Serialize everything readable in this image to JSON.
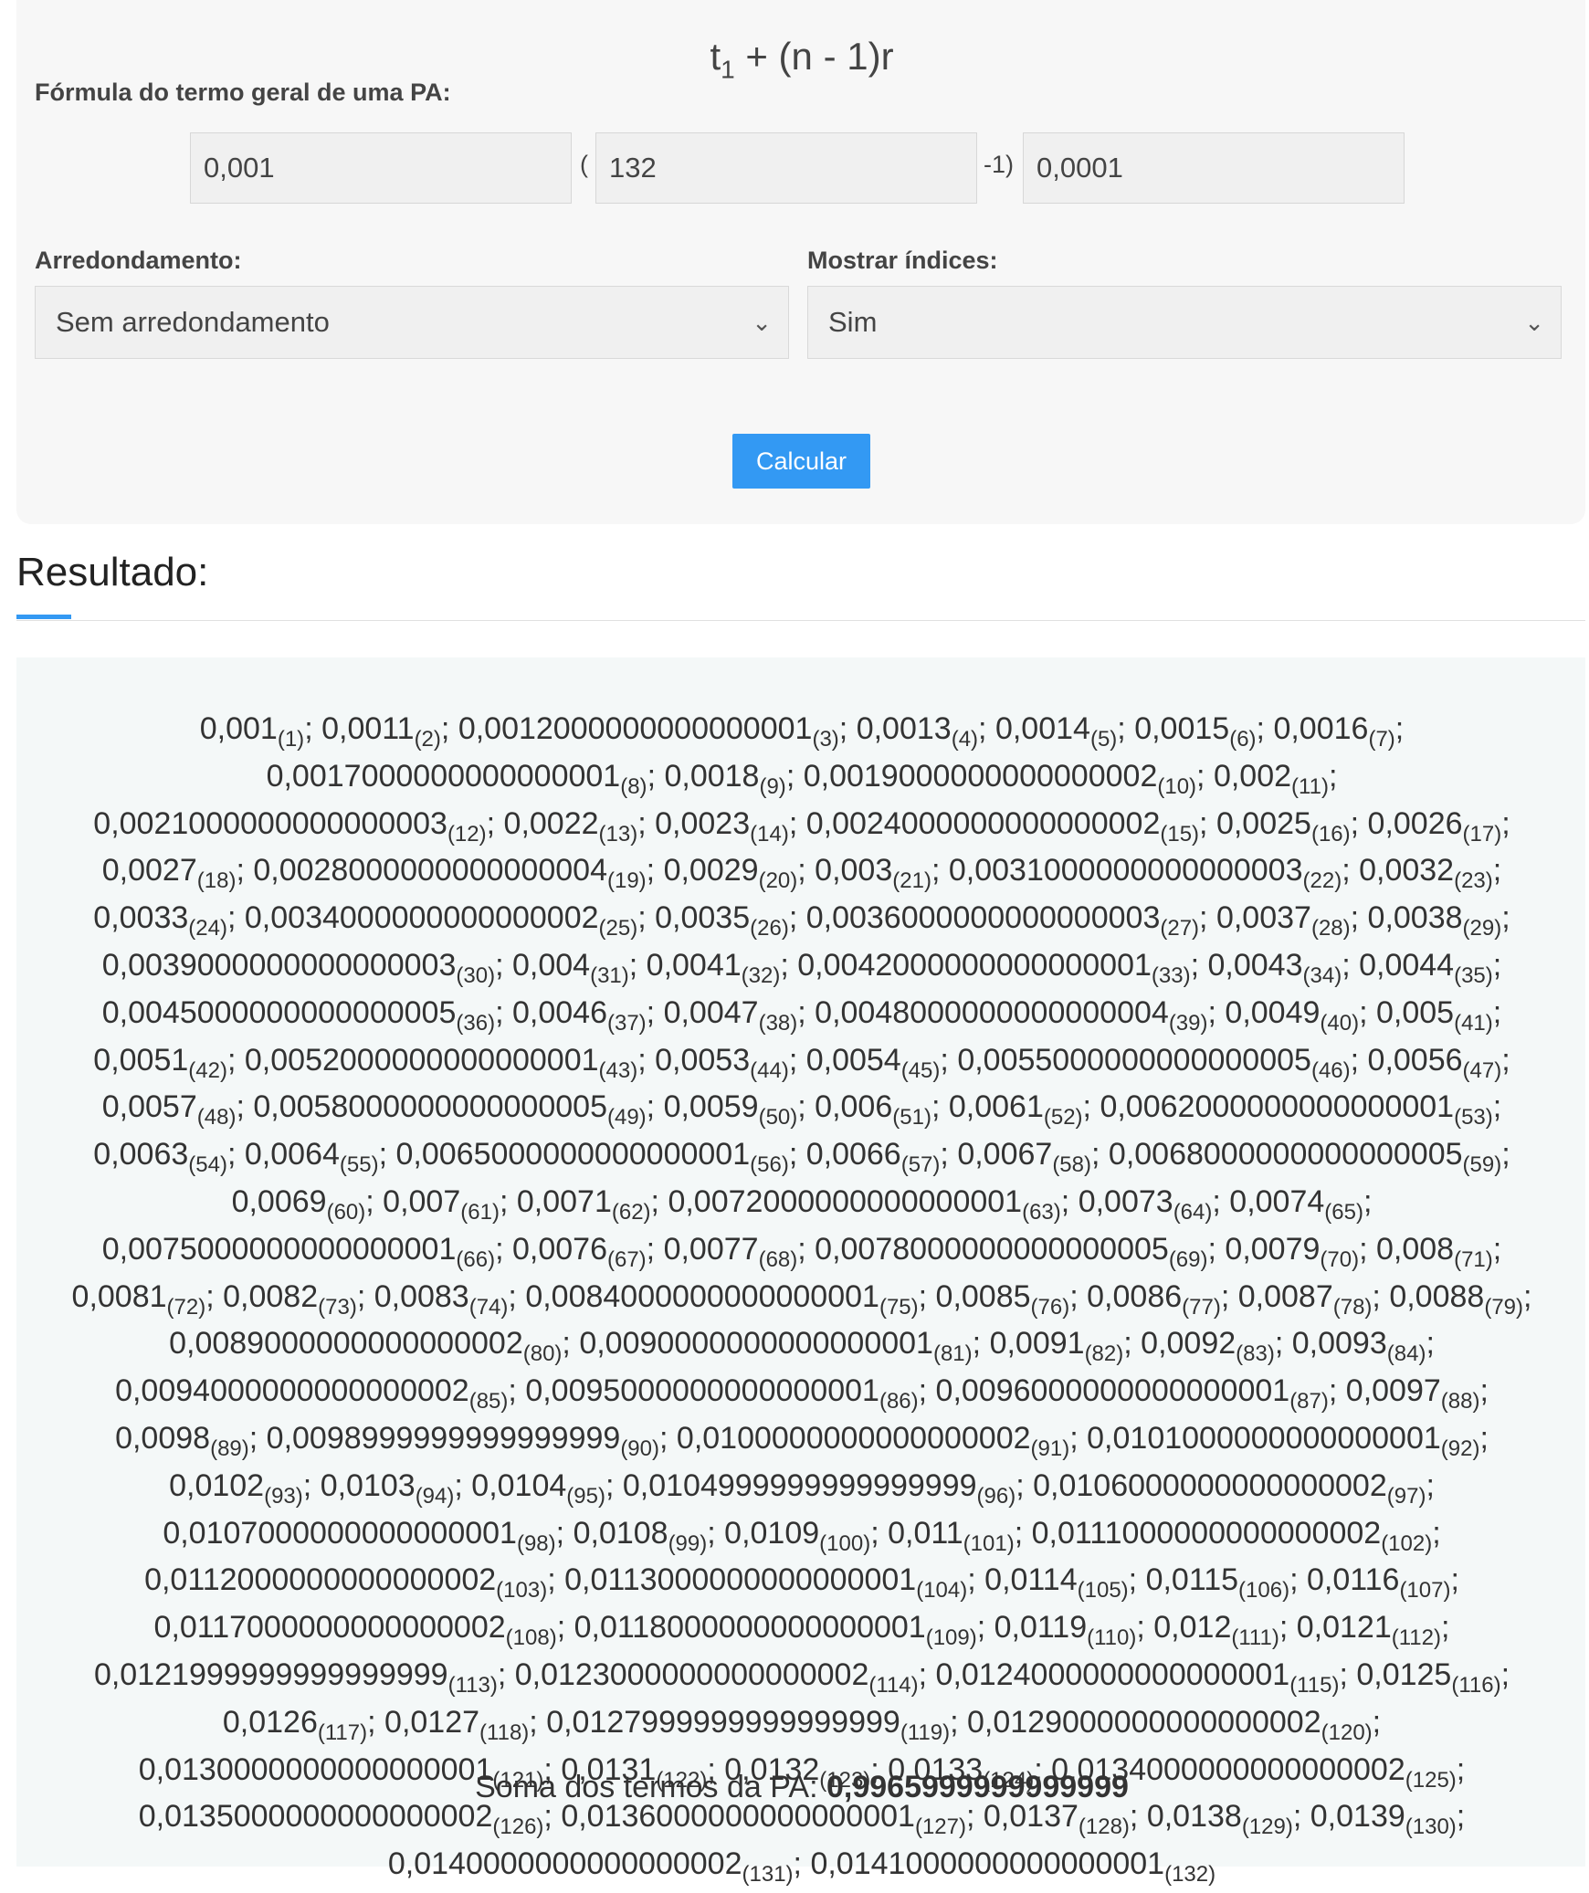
{
  "form": {
    "formula_title": {
      "base": "t",
      "sub": "1",
      "rest": " + (n - 1)r"
    },
    "formula_label": "Fórmula do termo geral de uma PA:",
    "first_term": "0,001",
    "open_paren": "(",
    "n_value": "132",
    "close_part": "-1)",
    "ratio": "0,0001",
    "rounding_label": "Arredondamento:",
    "rounding_value": "Sem arredondamento",
    "indices_label": "Mostrar índices:",
    "indices_value": "Sim",
    "calculate_button": "Calcular"
  },
  "result": {
    "title": "Resultado:",
    "terms": [
      [
        "0,001",
        "(1)"
      ],
      [
        "0,0011",
        "(2)"
      ],
      [
        "0,0012000000000000001",
        "(3)"
      ],
      [
        "0,0013",
        "(4)"
      ],
      [
        "0,0014",
        "(5)"
      ],
      [
        "0,0015",
        "(6)"
      ],
      [
        "0,0016",
        "(7)"
      ],
      [
        "0,0017000000000000001",
        "(8)"
      ],
      [
        "0,0018",
        "(9)"
      ],
      [
        "0,0019000000000000002",
        "(10)"
      ],
      [
        "0,002",
        "(11)"
      ],
      [
        "0,0021000000000000003",
        "(12)"
      ],
      [
        "0,0022",
        "(13)"
      ],
      [
        "0,0023",
        "(14)"
      ],
      [
        "0,0024000000000000002",
        "(15)"
      ],
      [
        "0,0025",
        "(16)"
      ],
      [
        "0,0026",
        "(17)"
      ],
      [
        "0,0027",
        "(18)"
      ],
      [
        "0,0028000000000000004",
        "(19)"
      ],
      [
        "0,0029",
        "(20)"
      ],
      [
        "0,003",
        "(21)"
      ],
      [
        "0,0031000000000000003",
        "(22)"
      ],
      [
        "0,0032",
        "(23)"
      ],
      [
        "0,0033",
        "(24)"
      ],
      [
        "0,0034000000000000002",
        "(25)"
      ],
      [
        "0,0035",
        "(26)"
      ],
      [
        "0,0036000000000000003",
        "(27)"
      ],
      [
        "0,0037",
        "(28)"
      ],
      [
        "0,0038",
        "(29)"
      ],
      [
        "0,0039000000000000003",
        "(30)"
      ],
      [
        "0,004",
        "(31)"
      ],
      [
        "0,0041",
        "(32)"
      ],
      [
        "0,0042000000000000001",
        "(33)"
      ],
      [
        "0,0043",
        "(34)"
      ],
      [
        "0,0044",
        "(35)"
      ],
      [
        "0,0045000000000000005",
        "(36)"
      ],
      [
        "0,0046",
        "(37)"
      ],
      [
        "0,0047",
        "(38)"
      ],
      [
        "0,0048000000000000004",
        "(39)"
      ],
      [
        "0,0049",
        "(40)"
      ],
      [
        "0,005",
        "(41)"
      ],
      [
        "0,0051",
        "(42)"
      ],
      [
        "0,0052000000000000001",
        "(43)"
      ],
      [
        "0,0053",
        "(44)"
      ],
      [
        "0,0054",
        "(45)"
      ],
      [
        "0,0055000000000000005",
        "(46)"
      ],
      [
        "0,0056",
        "(47)"
      ],
      [
        "0,0057",
        "(48)"
      ],
      [
        "0,0058000000000000005",
        "(49)"
      ],
      [
        "0,0059",
        "(50)"
      ],
      [
        "0,006",
        "(51)"
      ],
      [
        "0,0061",
        "(52)"
      ],
      [
        "0,0062000000000000001",
        "(53)"
      ],
      [
        "0,0063",
        "(54)"
      ],
      [
        "0,0064",
        "(55)"
      ],
      [
        "0,0065000000000000001",
        "(56)"
      ],
      [
        "0,0066",
        "(57)"
      ],
      [
        "0,0067",
        "(58)"
      ],
      [
        "0,0068000000000000005",
        "(59)"
      ],
      [
        "0,0069",
        "(60)"
      ],
      [
        "0,007",
        "(61)"
      ],
      [
        "0,0071",
        "(62)"
      ],
      [
        "0,0072000000000000001",
        "(63)"
      ],
      [
        "0,0073",
        "(64)"
      ],
      [
        "0,0074",
        "(65)"
      ],
      [
        "0,0075000000000000001",
        "(66)"
      ],
      [
        "0,0076",
        "(67)"
      ],
      [
        "0,0077",
        "(68)"
      ],
      [
        "0,0078000000000000005",
        "(69)"
      ],
      [
        "0,0079",
        "(70)"
      ],
      [
        "0,008",
        "(71)"
      ],
      [
        "0,0081",
        "(72)"
      ],
      [
        "0,0082",
        "(73)"
      ],
      [
        "0,0083",
        "(74)"
      ],
      [
        "0,0084000000000000001",
        "(75)"
      ],
      [
        "0,0085",
        "(76)"
      ],
      [
        "0,0086",
        "(77)"
      ],
      [
        "0,0087",
        "(78)"
      ],
      [
        "0,0088",
        "(79)"
      ],
      [
        "0,0089000000000000002",
        "(80)"
      ],
      [
        "0,0090000000000000001",
        "(81)"
      ],
      [
        "0,0091",
        "(82)"
      ],
      [
        "0,0092",
        "(83)"
      ],
      [
        "0,0093",
        "(84)"
      ],
      [
        "0,0094000000000000002",
        "(85)"
      ],
      [
        "0,0095000000000000001",
        "(86)"
      ],
      [
        "0,0096000000000000001",
        "(87)"
      ],
      [
        "0,0097",
        "(88)"
      ],
      [
        "0,0098",
        "(89)"
      ],
      [
        "0,0098999999999999999",
        "(90)"
      ],
      [
        "0,0100000000000000002",
        "(91)"
      ],
      [
        "0,0101000000000000001",
        "(92)"
      ],
      [
        "0,0102",
        "(93)"
      ],
      [
        "0,0103",
        "(94)"
      ],
      [
        "0,0104",
        "(95)"
      ],
      [
        "0,0104999999999999999",
        "(96)"
      ],
      [
        "0,0106000000000000002",
        "(97)"
      ],
      [
        "0,0107000000000000001",
        "(98)"
      ],
      [
        "0,0108",
        "(99)"
      ],
      [
        "0,0109",
        "(100)"
      ],
      [
        "0,011",
        "(101)"
      ],
      [
        "0,0111000000000000002",
        "(102)"
      ],
      [
        "0,0112000000000000002",
        "(103)"
      ],
      [
        "0,0113000000000000001",
        "(104)"
      ],
      [
        "0,0114",
        "(105)"
      ],
      [
        "0,0115",
        "(106)"
      ],
      [
        "0,0116",
        "(107)"
      ],
      [
        "0,0117000000000000002",
        "(108)"
      ],
      [
        "0,0118000000000000001",
        "(109)"
      ],
      [
        "0,0119",
        "(110)"
      ],
      [
        "0,012",
        "(111)"
      ],
      [
        "0,0121",
        "(112)"
      ],
      [
        "0,0121999999999999999",
        "(113)"
      ],
      [
        "0,0123000000000000002",
        "(114)"
      ],
      [
        "0,0124000000000000001",
        "(115)"
      ],
      [
        "0,0125",
        "(116)"
      ],
      [
        "0,0126",
        "(117)"
      ],
      [
        "0,0127",
        "(118)"
      ],
      [
        "0,0127999999999999999",
        "(119)"
      ],
      [
        "0,0129000000000000002",
        "(120)"
      ],
      [
        "0,0130000000000000001",
        "(121)"
      ],
      [
        "0,0131",
        "(122)"
      ],
      [
        "0,0132",
        "(123)"
      ],
      [
        "0,0133",
        "(124)"
      ],
      [
        "0,0134000000000000002",
        "(125)"
      ],
      [
        "0,0135000000000000002",
        "(126)"
      ],
      [
        "0,0136000000000000001",
        "(127)"
      ],
      [
        "0,0137",
        "(128)"
      ],
      [
        "0,0138",
        "(129)"
      ],
      [
        "0,0139",
        "(130)"
      ],
      [
        "0,0140000000000000002",
        "(131)"
      ],
      [
        "0,0141000000000000001",
        "(132)"
      ]
    ],
    "sum_label": "Soma dos termos da PA: ",
    "sum_value": "0,9965999999999999"
  },
  "colors": {
    "accent": "#3399f3",
    "panel": "#f7f7f7",
    "result_panel": "#f4f8f8"
  },
  "icons": {
    "select_arrow": "chevron-down-icon"
  }
}
